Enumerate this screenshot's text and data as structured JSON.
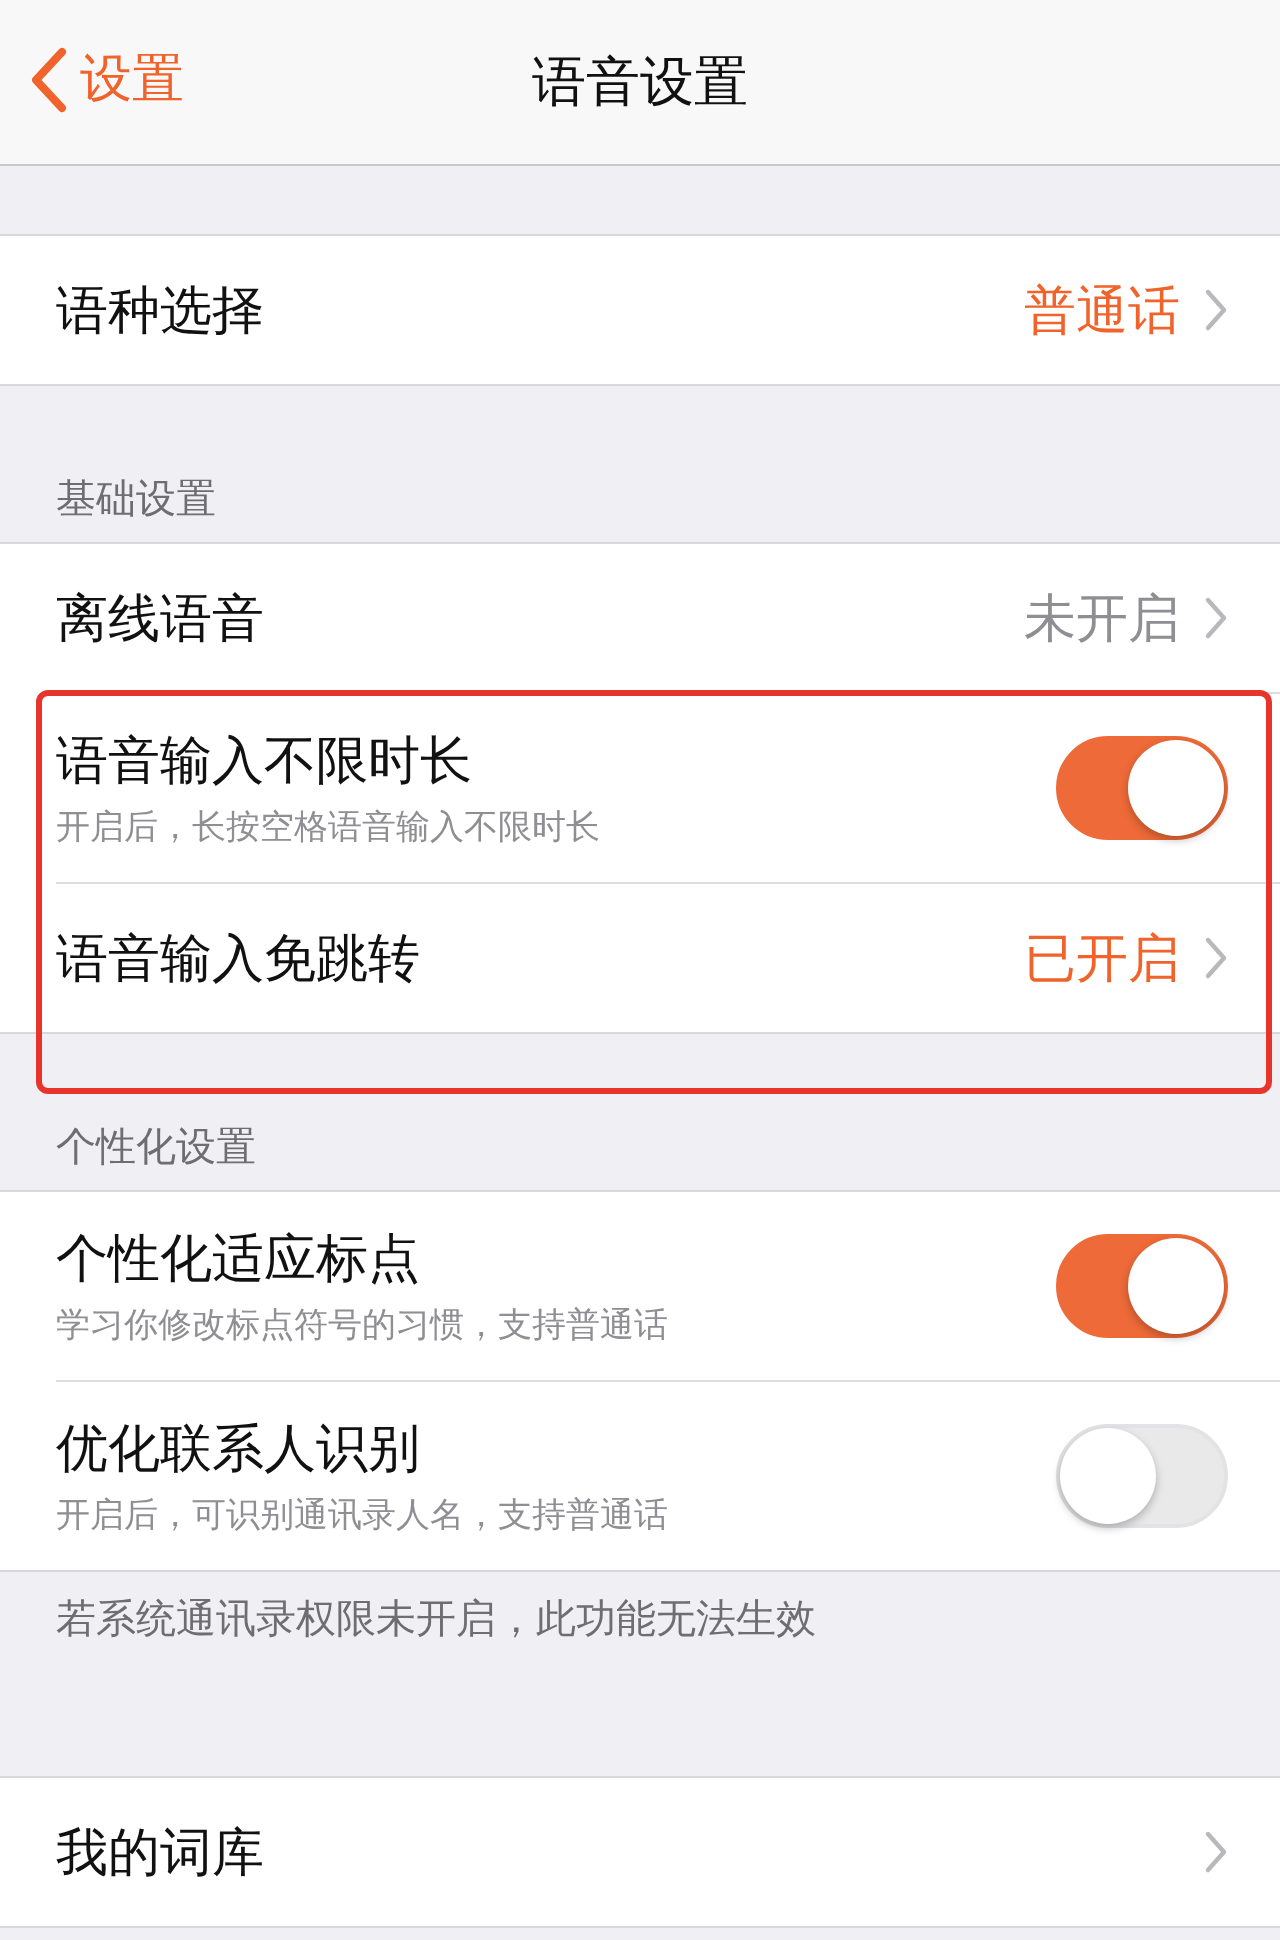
{
  "nav": {
    "back": "设置",
    "title": "语音设置"
  },
  "sections": [
    {
      "rows": [
        {
          "kind": "link",
          "label": "语种选择",
          "value": "普通话",
          "active": true,
          "boxed": false
        }
      ]
    },
    {
      "header": "基础设置",
      "rows": [
        {
          "kind": "link",
          "label": "离线语音",
          "value": "未开启",
          "active": false,
          "boxed": false
        },
        {
          "kind": "toggle",
          "label": "语音输入不限时长",
          "subtitle": "开启后，长按空格语音输入不限时长",
          "on": true,
          "boxed": true
        },
        {
          "kind": "link",
          "label": "语音输入免跳转",
          "value": "已开启",
          "active": true,
          "boxed": true
        }
      ]
    },
    {
      "header": "个性化设置",
      "rows": [
        {
          "kind": "toggle",
          "label": "个性化适应标点",
          "subtitle": "学习你修改标点符号的习惯，支持普通话",
          "on": true,
          "boxed": false
        },
        {
          "kind": "toggle",
          "label": "优化联系人识别",
          "subtitle": "开启后，可识别通讯录人名，支持普通话",
          "on": false,
          "boxed": false
        }
      ],
      "footer": "若系统通讯录权限未开启，此功能无法生效"
    },
    {
      "rows": [
        {
          "kind": "link",
          "label": "我的词库",
          "boxed": false
        }
      ]
    }
  ]
}
